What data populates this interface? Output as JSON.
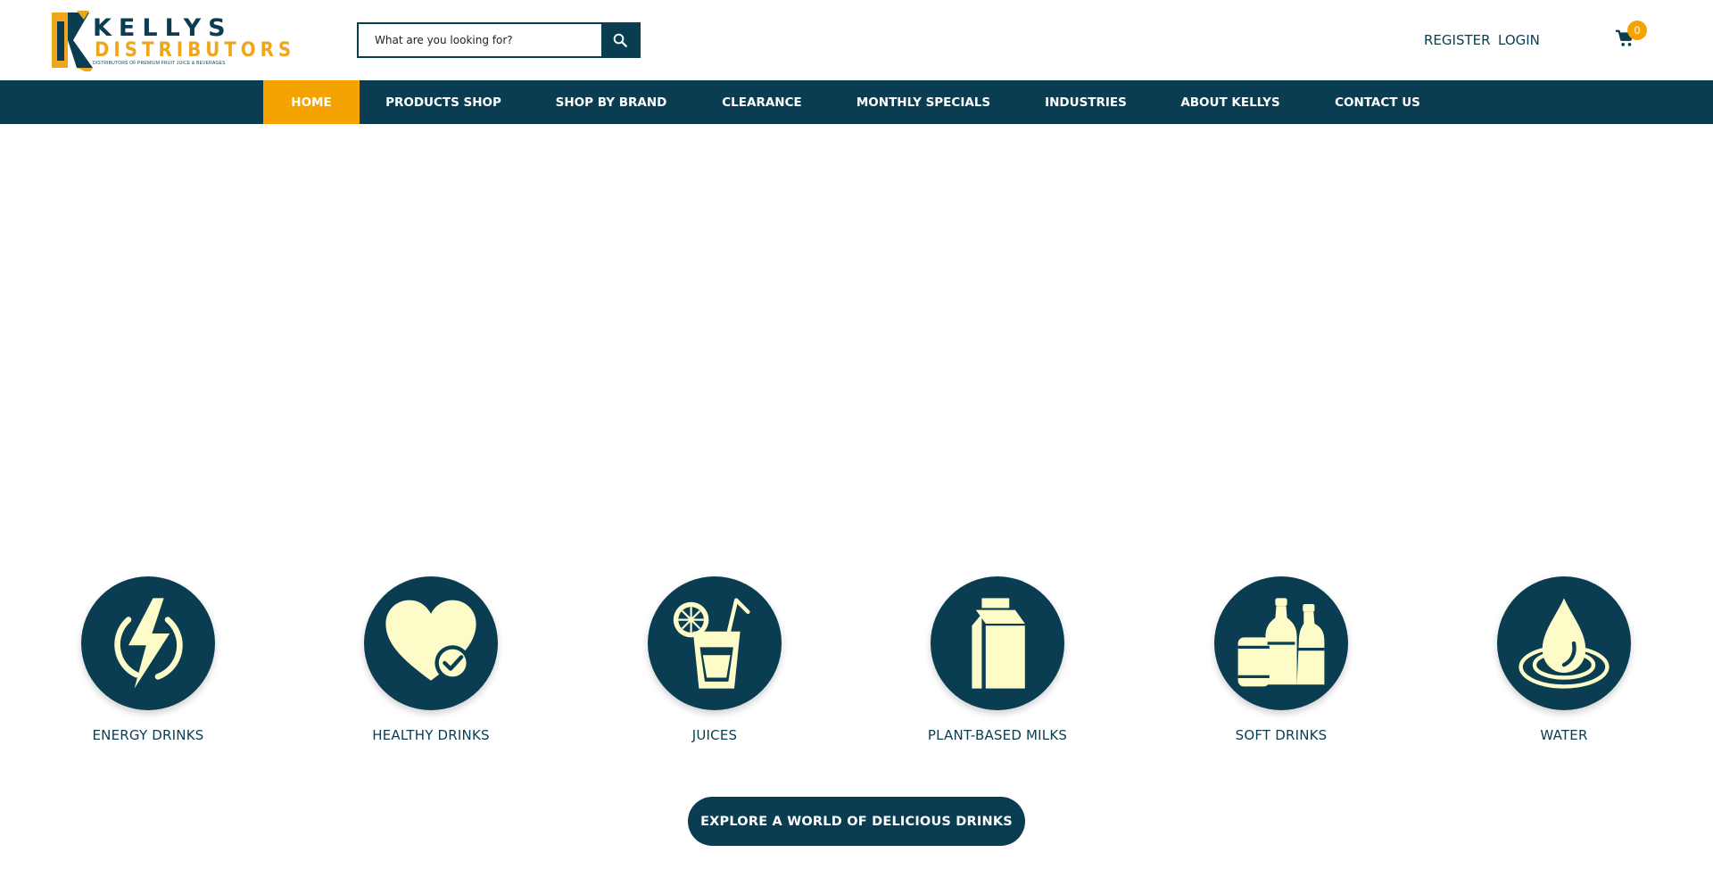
{
  "brand": {
    "name_top": "KELLYS",
    "name_bottom": "DISTRIBUTORS",
    "tagline": "DISTRIBUTORS OF PREMIUM FRUIT JUICE & BEVERAGES",
    "colors": {
      "primary": "#0a3d52",
      "accent": "#f5a300",
      "icon_fill": "#fdfbc8"
    }
  },
  "search": {
    "placeholder": "What are you looking for?",
    "icon": "search-icon"
  },
  "auth": {
    "register": "REGISTER",
    "login": "LOGIN"
  },
  "cart": {
    "count": "0",
    "icon": "cart-icon"
  },
  "nav": {
    "items": [
      {
        "label": "HOME",
        "active": true
      },
      {
        "label": "PRODUCTS SHOP"
      },
      {
        "label": "SHOP BY BRAND"
      },
      {
        "label": "CLEARANCE"
      },
      {
        "label": "MONTHLY SPECIALS"
      },
      {
        "label": "INDUSTRIES"
      },
      {
        "label": "ABOUT KELLYS"
      },
      {
        "label": "CONTACT US"
      }
    ]
  },
  "categories": [
    {
      "label": "ENERGY DRINKS",
      "icon": "lightning-icon"
    },
    {
      "label": "HEALTHY DRINKS",
      "icon": "heart-check-icon"
    },
    {
      "label": "JUICES",
      "icon": "juice-glass-icon"
    },
    {
      "label": "PLANT-BASED MILKS",
      "icon": "milk-carton-icon"
    },
    {
      "label": "SOFT DRINKS",
      "icon": "soft-drink-bottles-icon"
    },
    {
      "label": "WATER",
      "icon": "water-drop-icon"
    }
  ],
  "cta": {
    "label": "EXPLORE A WORLD OF DELICIOUS DRINKS"
  }
}
